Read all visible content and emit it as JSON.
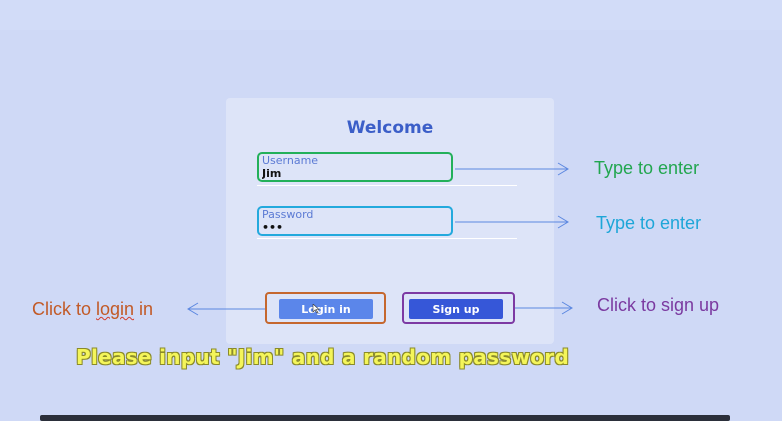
{
  "card": {
    "title": "Welcome",
    "username": {
      "label": "Username",
      "value": "Jim"
    },
    "password": {
      "label": "Password",
      "value": "•••"
    },
    "buttons": {
      "login_label": "Login in",
      "signup_label": "Sign up"
    }
  },
  "annotations": {
    "username_hint": "Type to enter",
    "password_hint": "Type to enter",
    "login_hint_prefix": "Click to ",
    "login_hint_word": "login",
    "login_hint_suffix": " in",
    "signup_hint": "Click to sign up"
  },
  "banner": {
    "text": "Please input \"Jim\" and a random password"
  },
  "colors": {
    "background": "#cfd9f6",
    "card": "#dde4f8",
    "title": "#3b5ec8",
    "username_border": "#23b05a",
    "password_border": "#23a9dd",
    "login_frame": "#c5672e",
    "signup_frame": "#7d3aa3",
    "login_button": "#5b86ea",
    "signup_button": "#3657d8",
    "banner_text": "#f4f55a",
    "arrow": "#5b87e0"
  },
  "icons": {
    "cursor": "pointer-cursor-icon"
  }
}
